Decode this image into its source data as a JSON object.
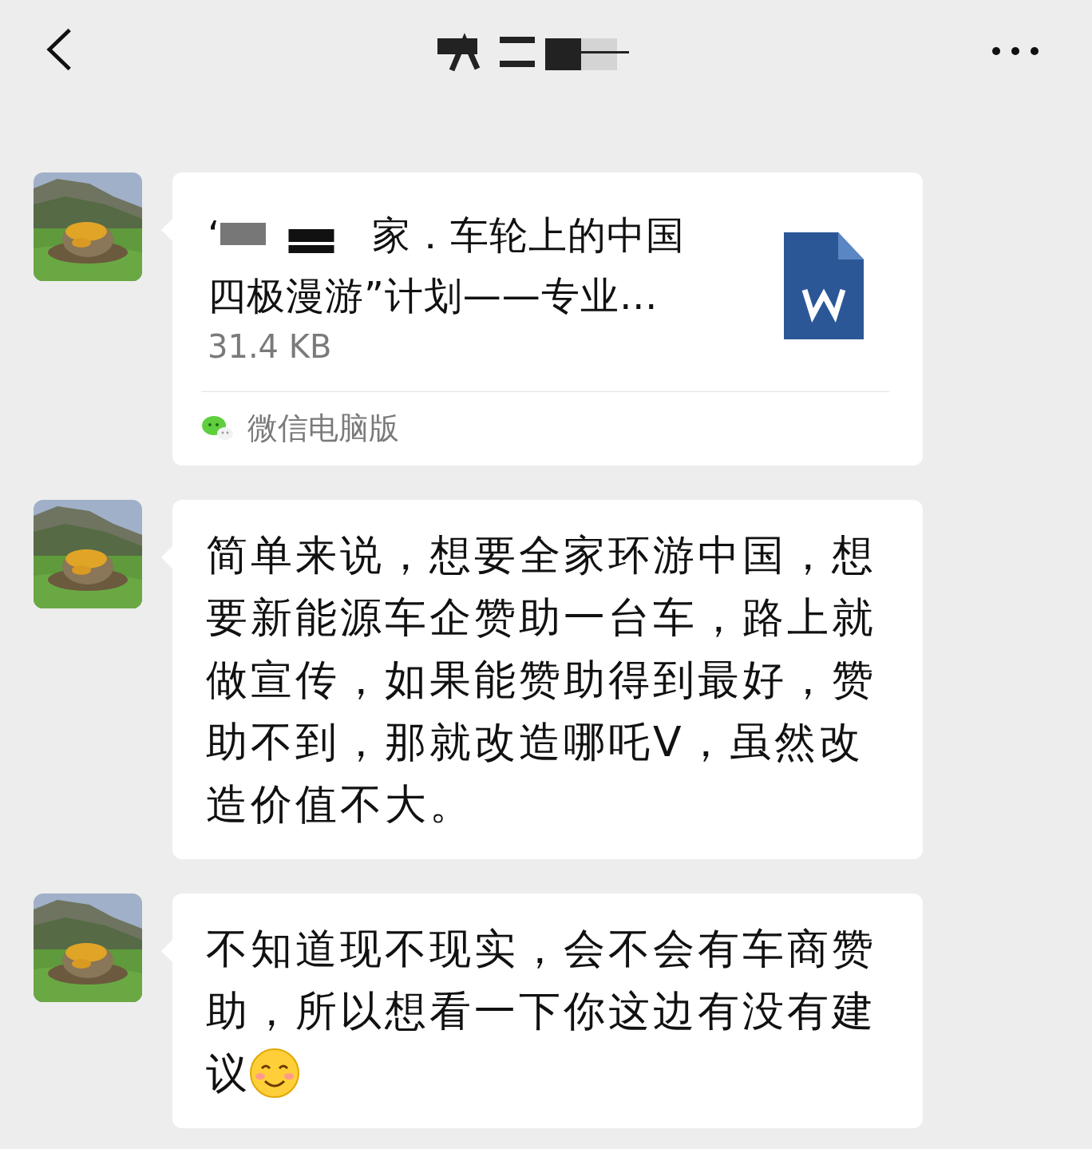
{
  "header": {
    "title": {
      "kind": "redacted"
    }
  },
  "messages": [
    {
      "kind": "file",
      "name_line_1": [
        {
          "kind": "text",
          "text": "‘"
        },
        {
          "kind": "redacted"
        },
        {
          "kind": "text",
          "text": "家．车轮上的中国"
        }
      ],
      "name_line_2": "四极漫游”计划——专业…",
      "size": "31.4 KB",
      "source": "微信电脑版"
    },
    {
      "kind": "text",
      "text": "简单来说，想要全家环游中国，想要新能源车企赞助一台车，路上就做宣传，如果能赞助得到最好，赞助不到，那就改造哪吒V，虽然改造价值不大。"
    },
    {
      "kind": "text-emoji",
      "text": "不知道现不现实，会不会有车商赞助，所以想看一下你这边有没有建",
      "tail": "议"
    }
  ]
}
